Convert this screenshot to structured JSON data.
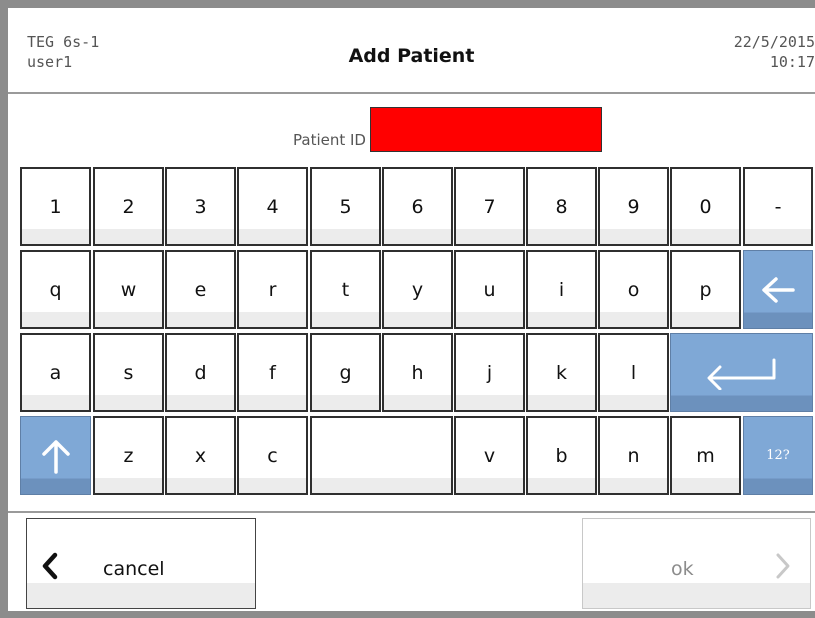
{
  "header": {
    "device": "TEG 6s-1",
    "user": "user1",
    "title": "Add Patient",
    "date": "22/5/2015",
    "time": "10:17"
  },
  "form": {
    "patient_id_label": "Patient ID",
    "patient_id_value": "",
    "field_color": "#ff0000"
  },
  "keyboard": {
    "row1": [
      "1",
      "2",
      "3",
      "4",
      "5",
      "6",
      "7",
      "8",
      "9",
      "0",
      "-"
    ],
    "row2": [
      "q",
      "w",
      "e",
      "r",
      "t",
      "y",
      "u",
      "i",
      "o",
      "p"
    ],
    "row3": [
      "a",
      "s",
      "d",
      "f",
      "g",
      "h",
      "j",
      "k",
      "l"
    ],
    "row4": [
      "z",
      "x",
      "c",
      "v",
      "b",
      "n",
      "m"
    ],
    "symbols_key": "12?",
    "backspace_icon": "arrow-left-icon",
    "enter_icon": "enter-icon",
    "shift_icon": "arrow-up-icon",
    "accent_color": "#7fa8d6"
  },
  "actions": {
    "cancel": "cancel",
    "ok": "ok"
  }
}
